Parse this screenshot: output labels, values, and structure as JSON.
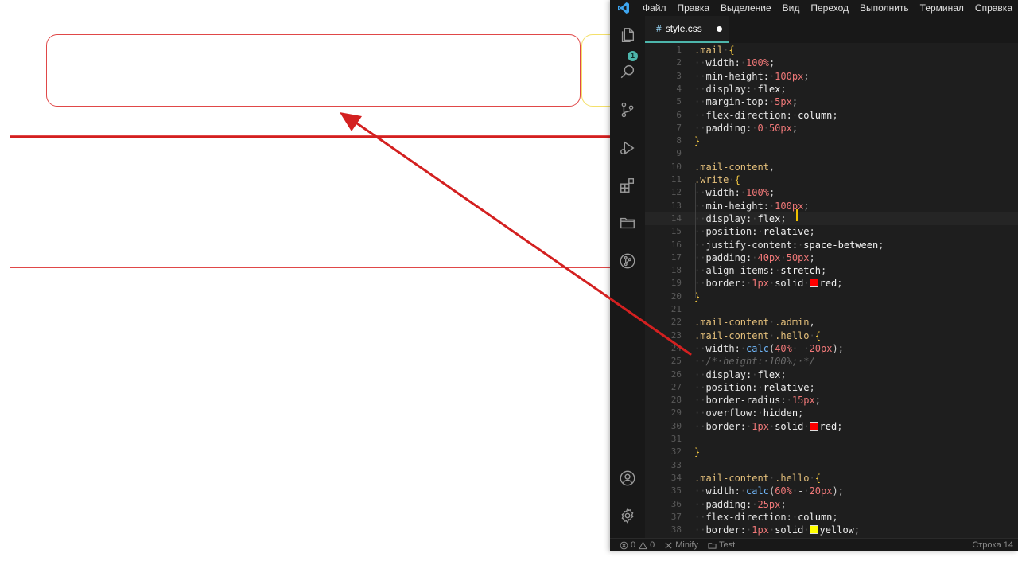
{
  "menu": [
    "Файл",
    "Правка",
    "Выделение",
    "Вид",
    "Переход",
    "Выполнить",
    "Терминал",
    "Справка"
  ],
  "tab": {
    "icon": "#",
    "filename": "style.css"
  },
  "explorer_badge": "1",
  "code_lines": [
    {
      "n": "1",
      "h": "<span class='t-sel'>.mail</span><span class='t-ws'>·</span><span class='t-brace'>{</span>"
    },
    {
      "n": "2",
      "h": "<span class='t-ws'>··</span><span class='t-prop'>width:</span><span class='t-ws'>·</span><span class='t-num'>100%</span><span class='t-op'>;</span>"
    },
    {
      "n": "3",
      "h": "<span class='t-ws'>··</span><span class='t-prop'>min-height:</span><span class='t-ws'>·</span><span class='t-num'>100px</span><span class='t-op'>;</span>"
    },
    {
      "n": "4",
      "h": "<span class='t-ws'>··</span><span class='t-prop'>display:</span><span class='t-ws'>·</span><span class='t-val'>flex</span><span class='t-op'>;</span>"
    },
    {
      "n": "5",
      "h": "<span class='t-ws'>··</span><span class='t-prop'>margin-top:</span><span class='t-ws'>·</span><span class='t-num'>5px</span><span class='t-op'>;</span>"
    },
    {
      "n": "6",
      "h": "<span class='t-ws'>··</span><span class='t-prop'>flex-direction:</span><span class='t-ws'>·</span><span class='t-val'>column</span><span class='t-op'>;</span>"
    },
    {
      "n": "7",
      "h": "<span class='t-ws'>··</span><span class='t-prop'>padding:</span><span class='t-ws'>·</span><span class='t-num'>0</span><span class='t-ws'>·</span><span class='t-num'>50px</span><span class='t-op'>;</span>"
    },
    {
      "n": "8",
      "h": "<span class='t-brace'>}</span>"
    },
    {
      "n": "9",
      "h": ""
    },
    {
      "n": "10",
      "h": "<span class='t-sel'>.mail-content</span><span class='t-op'>,</span>"
    },
    {
      "n": "11",
      "h": "<span class='t-sel'>.write</span><span class='t-ws'>·</span><span class='t-brace'>{</span>"
    },
    {
      "n": "12",
      "h": "<span class='t-ws'>··</span><span class='t-prop'>width:</span><span class='t-ws'>·</span><span class='t-num'>100%</span><span class='t-op'>;</span>"
    },
    {
      "n": "13",
      "h": "<span class='t-ws'>··</span><span class='t-prop'>min-height:</span><span class='t-ws'>·</span><span class='t-num'>100px</span><span class='t-op'>;</span>"
    },
    {
      "n": "14",
      "h": "<span class='t-ws'>··</span><span class='t-prop'>display:</span><span class='t-ws'>·</span><span class='t-val'>flex</span><span class='t-op'>;</span>"
    },
    {
      "n": "15",
      "h": "<span class='t-ws'>··</span><span class='t-prop'>position:</span><span class='t-ws'>·</span><span class='t-val'>relative</span><span class='t-op'>;</span>"
    },
    {
      "n": "16",
      "h": "<span class='t-ws'>··</span><span class='t-prop'>justify-content:</span><span class='t-ws'>·</span><span class='t-val'>space-between</span><span class='t-op'>;</span>"
    },
    {
      "n": "17",
      "h": "<span class='t-ws'>··</span><span class='t-prop'>padding:</span><span class='t-ws'>·</span><span class='t-num'>40px</span><span class='t-ws'>·</span><span class='t-num'>50px</span><span class='t-op'>;</span>"
    },
    {
      "n": "18",
      "h": "<span class='t-ws'>··</span><span class='t-prop'>align-items:</span><span class='t-ws'>·</span><span class='t-val'>stretch</span><span class='t-op'>;</span>"
    },
    {
      "n": "19",
      "h": "<span class='t-ws'>··</span><span class='t-prop'>border:</span><span class='t-ws'>·</span><span class='t-num'>1px</span><span class='t-ws'>·</span><span class='t-val'>solid</span><span class='t-ws'>·</span><span class='swatch' style='background:#ff0000'></span><span class='t-val'>red</span><span class='t-op'>;</span>"
    },
    {
      "n": "20",
      "h": "<span class='t-brace'>}</span>"
    },
    {
      "n": "21",
      "h": ""
    },
    {
      "n": "22",
      "h": "<span class='t-sel'>.mail-content</span><span class='t-ws'>·</span><span class='t-sel'>.admin</span><span class='t-op'>,</span>"
    },
    {
      "n": "23",
      "h": "<span class='t-sel'>.mail-content</span><span class='t-ws'>·</span><span class='t-sel'>.hello</span><span class='t-ws'>·</span><span class='t-brace'>{</span>"
    },
    {
      "n": "24",
      "h": "<span class='t-ws'>··</span><span class='t-prop'>width:</span><span class='t-ws'>·</span><span class='t-fn'>calc</span><span class='t-op'>(</span><span class='t-num'>40%</span><span class='t-ws'>·</span><span class='t-op'>-</span><span class='t-ws'>·</span><span class='t-num'>20px</span><span class='t-op'>);</span>"
    },
    {
      "n": "25",
      "h": "<span class='t-ws'>··</span><span class='t-cmt'>/*·height:·100%;·*/</span>"
    },
    {
      "n": "26",
      "h": "<span class='t-ws'>··</span><span class='t-prop'>display:</span><span class='t-ws'>·</span><span class='t-val'>flex</span><span class='t-op'>;</span>"
    },
    {
      "n": "27",
      "h": "<span class='t-ws'>··</span><span class='t-prop'>position:</span><span class='t-ws'>·</span><span class='t-val'>relative</span><span class='t-op'>;</span>"
    },
    {
      "n": "28",
      "h": "<span class='t-ws'>··</span><span class='t-prop'>border-radius:</span><span class='t-ws'>·</span><span class='t-num'>15px</span><span class='t-op'>;</span>"
    },
    {
      "n": "29",
      "h": "<span class='t-ws'>··</span><span class='t-prop'>overflow:</span><span class='t-ws'>·</span><span class='t-val'>hidden</span><span class='t-op'>;</span>"
    },
    {
      "n": "30",
      "h": "<span class='t-ws'>··</span><span class='t-prop'>border:</span><span class='t-ws'>·</span><span class='t-num'>1px</span><span class='t-ws'>·</span><span class='t-val'>solid</span><span class='t-ws'>·</span><span class='swatch' style='background:#ff0000'></span><span class='t-val'>red</span><span class='t-op'>;</span>"
    },
    {
      "n": "31",
      "h": ""
    },
    {
      "n": "32",
      "h": "<span class='t-brace'>}</span>"
    },
    {
      "n": "33",
      "h": ""
    },
    {
      "n": "34",
      "h": "<span class='t-sel'>.mail-content</span><span class='t-ws'>·</span><span class='t-sel'>.hello</span><span class='t-ws'>·</span><span class='t-brace'>{</span>"
    },
    {
      "n": "35",
      "h": "<span class='t-ws'>··</span><span class='t-prop'>width:</span><span class='t-ws'>·</span><span class='t-fn'>calc</span><span class='t-op'>(</span><span class='t-num'>60%</span><span class='t-ws'>·</span><span class='t-op'>-</span><span class='t-ws'>·</span><span class='t-num'>20px</span><span class='t-op'>);</span>"
    },
    {
      "n": "36",
      "h": "<span class='t-ws'>··</span><span class='t-prop'>padding:</span><span class='t-ws'>·</span><span class='t-num'>25px</span><span class='t-op'>;</span>"
    },
    {
      "n": "37",
      "h": "<span class='t-ws'>··</span><span class='t-prop'>flex-direction:</span><span class='t-ws'>·</span><span class='t-val'>column</span><span class='t-op'>;</span>"
    },
    {
      "n": "38",
      "h": "<span class='t-ws'>··</span><span class='t-prop'>border:</span><span class='t-ws'>·</span><span class='t-num'>1px</span><span class='t-ws'>·</span><span class='t-val'>solid</span><span class='t-ws'>·</span><span class='swatch' style='background:#ffff00'></span><span class='t-val'>yellow</span><span class='t-op'>;</span>"
    }
  ],
  "statusbar": {
    "errors": "0",
    "warnings": "0",
    "minify": "Minify",
    "test": "Test",
    "position": "Строка 14"
  },
  "colors": {
    "editor_bg": "#1e1e1e",
    "accent": "#4db6ac",
    "preview_border": "#e04848",
    "hello_border": "#f4e06a",
    "arrow": "#d32020"
  }
}
